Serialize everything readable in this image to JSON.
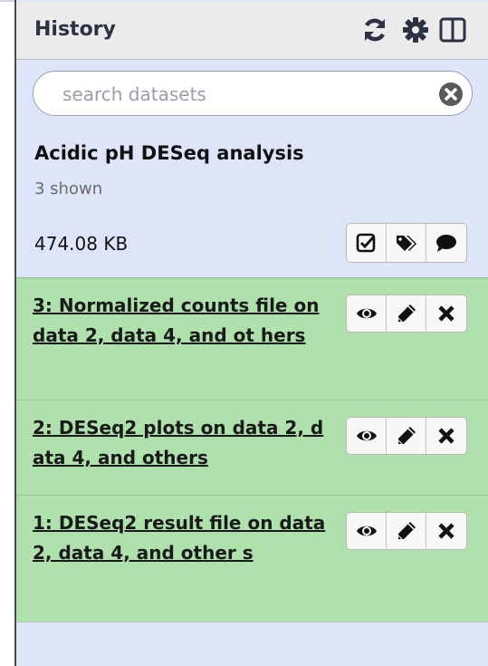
{
  "header": {
    "title": "History",
    "icons": [
      "refresh-icon",
      "gear-icon",
      "columns-icon"
    ]
  },
  "search": {
    "placeholder": "search datasets",
    "value": ""
  },
  "history": {
    "name": "Acidic pH DESeq analysis",
    "shown": "3 shown",
    "size": "474.08 KB",
    "actions": [
      "checkbox-select-icon",
      "tags-icon",
      "comment-icon"
    ]
  },
  "datasets": [
    {
      "label": "3: Normalized counts file on data 2, data 4, and ot hers ",
      "state_color": "#afe1ad"
    },
    {
      "label": "2: DESeq2 plots on data 2, data 4, and others ",
      "state_color": "#afe1ad"
    },
    {
      "label": "1: DESeq2 result file on data 2, data 4, and other s ",
      "state_color": "#afe1ad"
    }
  ],
  "dataset_actions": [
    "eye-icon",
    "pencil-icon",
    "close-icon"
  ],
  "colors": {
    "panel_bg": "#dfe5f9",
    "header_bg": "#ebebeb",
    "dataset_ok": "#afe1ad"
  }
}
